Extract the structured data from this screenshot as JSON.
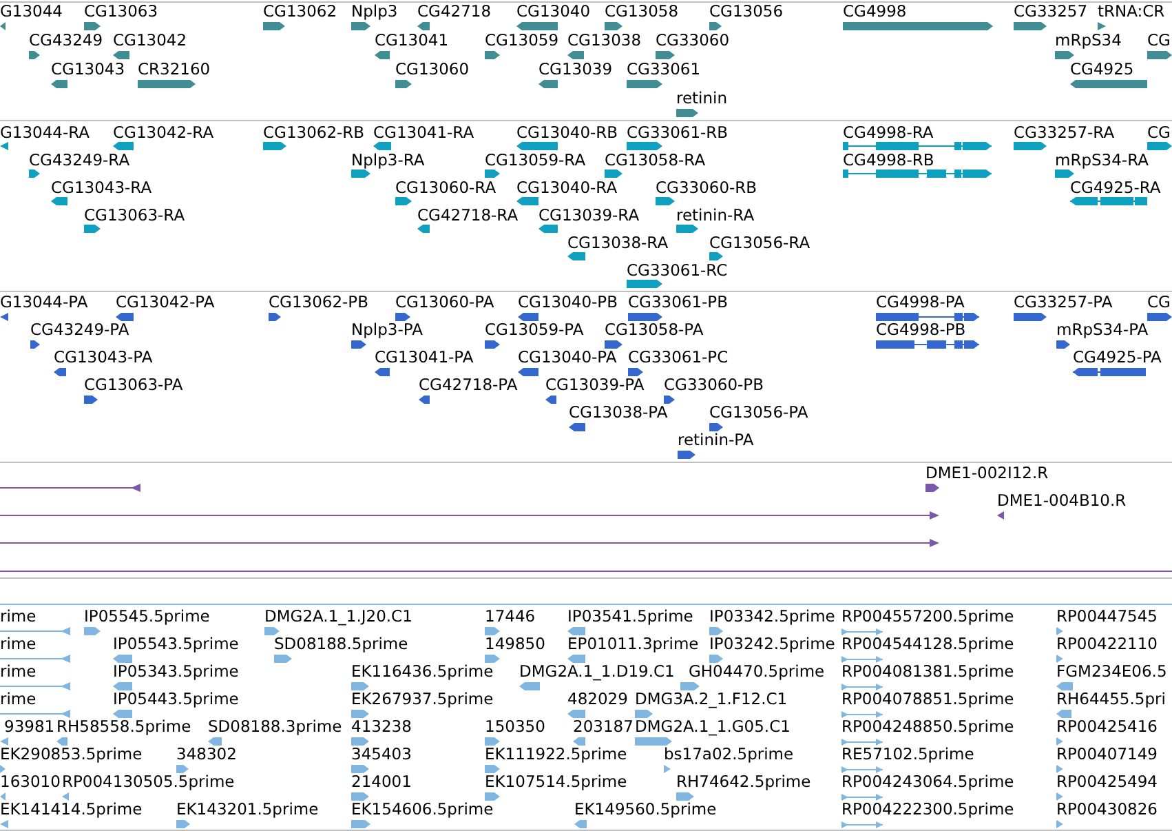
{
  "tracks": [
    {
      "kind": "gene",
      "color": "#418d93",
      "rows": [
        {
          "features": [
            {
              "label": "G13044",
              "reverse": true
            },
            {
              "label": "CG13063",
              "reverse": false
            },
            {
              "label": "CG13062",
              "reverse": false
            },
            {
              "label": "Nplp3",
              "reverse": false
            },
            {
              "label": "CG42718",
              "reverse": true
            },
            {
              "label": "CG13040",
              "reverse": true
            },
            {
              "label": "CG13058",
              "reverse": false
            },
            {
              "label": "CG13056",
              "reverse": false
            },
            {
              "label": "CG4998",
              "reverse": false
            },
            {
              "label": "CG33257",
              "reverse": false
            },
            {
              "label": "tRNA:CR",
              "reverse": false
            }
          ]
        },
        {
          "features": [
            {
              "label": "CG43249",
              "reverse": false
            },
            {
              "label": "CG13042",
              "reverse": true
            },
            {
              "label": "CG13041",
              "reverse": true
            },
            {
              "label": "CG13059",
              "reverse": false
            },
            {
              "label": "CG13038",
              "reverse": true
            },
            {
              "label": "CG33060",
              "reverse": false
            },
            {
              "label": "mRpS34",
              "reverse": false
            },
            {
              "label": "CG",
              "reverse": false
            }
          ]
        },
        {
          "features": [
            {
              "label": "CG13043",
              "reverse": true
            },
            {
              "label": "CR32160",
              "reverse": false
            },
            {
              "label": "CG13060",
              "reverse": false
            },
            {
              "label": "CG13039",
              "reverse": true
            },
            {
              "label": "CG33061",
              "reverse": false
            },
            {
              "label": "CG4925",
              "reverse": true
            }
          ]
        },
        {
          "features": [
            {
              "label": "retinin",
              "reverse": false
            }
          ]
        }
      ]
    },
    {
      "kind": "transcript",
      "color": "#10a0bf",
      "rows": [
        {
          "features": [
            {
              "label": "G13044-RA",
              "reverse": true
            },
            {
              "label": "CG13042-RA",
              "reverse": true
            },
            {
              "label": "CG13062-RB",
              "reverse": false
            },
            {
              "label": "CG13041-RA",
              "reverse": true
            },
            {
              "label": "CG13040-RB",
              "reverse": true
            },
            {
              "label": "CG33061-RB",
              "reverse": false
            },
            {
              "label": "CG4998-RA",
              "reverse": false
            },
            {
              "label": "CG33257-RA",
              "reverse": false
            },
            {
              "label": "CG",
              "reverse": false
            }
          ]
        },
        {
          "features": [
            {
              "label": "CG43249-RA",
              "reverse": false
            },
            {
              "label": "Nplp3-RA",
              "reverse": false
            },
            {
              "label": "CG13059-RA",
              "reverse": false
            },
            {
              "label": "CG13058-RA",
              "reverse": false
            },
            {
              "label": "CG4998-RB",
              "reverse": false
            },
            {
              "label": "mRpS34-RA",
              "reverse": false
            }
          ]
        },
        {
          "features": [
            {
              "label": "CG13043-RA",
              "reverse": true
            },
            {
              "label": "CG13060-RA",
              "reverse": false
            },
            {
              "label": "CG13040-RA",
              "reverse": true
            },
            {
              "label": "CG33060-RB",
              "reverse": false
            },
            {
              "label": "CG4925-RA",
              "reverse": true
            }
          ]
        },
        {
          "features": [
            {
              "label": "CG13063-RA",
              "reverse": false
            },
            {
              "label": "CG42718-RA",
              "reverse": true
            },
            {
              "label": "CG13039-RA",
              "reverse": true
            },
            {
              "label": "retinin-RA",
              "reverse": false
            }
          ]
        },
        {
          "features": [
            {
              "label": "CG13038-RA",
              "reverse": true
            },
            {
              "label": "CG13056-RA",
              "reverse": false
            }
          ]
        },
        {
          "features": [
            {
              "label": "CG33061-RC",
              "reverse": false
            }
          ]
        }
      ]
    },
    {
      "kind": "protein",
      "color": "#3468cc",
      "rows": [
        {
          "features": [
            {
              "label": "G13044-PA",
              "reverse": true
            },
            {
              "label": "CG13042-PA",
              "reverse": true
            },
            {
              "label": "CG13062-PB",
              "reverse": false
            },
            {
              "label": "CG13060-PA",
              "reverse": false
            },
            {
              "label": "CG13040-PB",
              "reverse": true
            },
            {
              "label": "CG33061-PB",
              "reverse": false
            },
            {
              "label": "CG4998-PA",
              "reverse": false
            },
            {
              "label": "CG33257-PA",
              "reverse": false
            },
            {
              "label": "CG",
              "reverse": false
            }
          ]
        },
        {
          "features": [
            {
              "label": "CG43249-PA",
              "reverse": false
            },
            {
              "label": "Nplp3-PA",
              "reverse": false
            },
            {
              "label": "CG13059-PA",
              "reverse": false
            },
            {
              "label": "CG13058-PA",
              "reverse": false
            },
            {
              "label": "CG4998-PB",
              "reverse": false
            },
            {
              "label": "mRpS34-PA",
              "reverse": false
            }
          ]
        },
        {
          "features": [
            {
              "label": "CG13043-PA",
              "reverse": true
            },
            {
              "label": "CG13041-PA",
              "reverse": true
            },
            {
              "label": "CG13040-PA",
              "reverse": true
            },
            {
              "label": "CG33061-PC",
              "reverse": false
            },
            {
              "label": "CG4925-PA",
              "reverse": true
            }
          ]
        },
        {
          "features": [
            {
              "label": "CG13063-PA",
              "reverse": false
            },
            {
              "label": "CG42718-PA",
              "reverse": true
            },
            {
              "label": "CG13039-PA",
              "reverse": true
            },
            {
              "label": "CG33060-PB",
              "reverse": false
            }
          ]
        },
        {
          "features": [
            {
              "label": "CG13038-PA",
              "reverse": true
            },
            {
              "label": "CG13056-PA",
              "reverse": false
            }
          ]
        },
        {
          "features": [
            {
              "label": "retinin-PA",
              "reverse": false
            }
          ]
        }
      ]
    },
    {
      "kind": "clone",
      "color": "#7b58a8",
      "rows": [
        {
          "features": [
            {
              "reverse": true
            },
            {
              "label": "DME1-002I12.R",
              "reverse": false
            }
          ]
        },
        {
          "features": [
            {
              "reverse": false
            },
            {
              "label": "DME1-004B10.R",
              "reverse": true
            }
          ]
        },
        {
          "features": [
            {
              "reverse": false
            }
          ]
        },
        {
          "features": [
            {
              "reverse": false
            }
          ]
        }
      ]
    },
    {
      "kind": "est",
      "color": "#80b6e0",
      "rows": [
        {
          "features": [
            {
              "label": "rime",
              "reverse": true
            },
            {
              "label": "IP05545.5prime",
              "reverse": false
            },
            {
              "label": "DMG2A.1_1.J20.C1",
              "reverse": false
            },
            {
              "label": "17446",
              "reverse": false
            },
            {
              "label": "IP03541.5prime",
              "reverse": true
            },
            {
              "label": "IP03342.5prime",
              "reverse": false
            },
            {
              "label": "RP004557200.5prime",
              "reverse": false
            },
            {
              "label": "RP00447545",
              "reverse": false
            }
          ]
        },
        {
          "features": [
            {
              "label": "rime",
              "reverse": true
            },
            {
              "label": "IP05543.5prime",
              "reverse": true
            },
            {
              "label": "SD08188.5prime",
              "reverse": false
            },
            {
              "label": "149850",
              "reverse": false
            },
            {
              "label": "EP01011.3prime",
              "reverse": true
            },
            {
              "label": "IP03242.5prime",
              "reverse": false
            },
            {
              "label": "RP004544128.5prime",
              "reverse": false
            },
            {
              "label": "RP00422110",
              "reverse": false
            }
          ]
        },
        {
          "features": [
            {
              "label": "rime",
              "reverse": true
            },
            {
              "label": "IP05343.5prime",
              "reverse": true
            },
            {
              "label": "EK116436.5prime",
              "reverse": false
            },
            {
              "label": "DMG2A.1_1.D19.C1",
              "reverse": true
            },
            {
              "label": "GH04470.5prime",
              "reverse": false
            },
            {
              "label": "RP004081381.5prime",
              "reverse": false
            },
            {
              "label": "FGM234E06.5",
              "reverse": true
            }
          ]
        },
        {
          "features": [
            {
              "label": "rime",
              "reverse": true
            },
            {
              "label": "IP05443.5prime",
              "reverse": true
            },
            {
              "label": "EK267937.5prime",
              "reverse": false
            },
            {
              "label": "482029",
              "reverse": true
            },
            {
              "label": "DMG3A.2_1.F12.C1",
              "reverse": false
            },
            {
              "label": "RP004078851.5prime",
              "reverse": false
            },
            {
              "label": "RH64455.5pri",
              "reverse": true
            }
          ]
        },
        {
          "features": [
            {
              "label": "93981",
              "reverse": true
            },
            {
              "label": "RH58558.5prime",
              "reverse": true
            },
            {
              "label": "SD08188.3prime",
              "reverse": true
            },
            {
              "label": "413238",
              "reverse": false
            },
            {
              "label": "150350",
              "reverse": false
            },
            {
              "label": "203187",
              "reverse": true
            },
            {
              "label": "DMG2A.1_1.G05.C1",
              "reverse": false
            },
            {
              "label": "RP004248850.5prime",
              "reverse": false
            },
            {
              "label": "RP00425416",
              "reverse": false
            }
          ]
        },
        {
          "features": [
            {
              "label": "EK290853.5prime",
              "reverse": false
            },
            {
              "label": "348302",
              "reverse": false
            },
            {
              "label": "345403",
              "reverse": false
            },
            {
              "label": "EK111922.5prime",
              "reverse": false
            },
            {
              "label": "bs17a02.5prime",
              "reverse": false
            },
            {
              "label": "RE57102.5prime",
              "reverse": false
            },
            {
              "label": "RP00407149",
              "reverse": false
            }
          ]
        },
        {
          "features": [
            {
              "label": "163010",
              "reverse": true
            },
            {
              "label": "RP004130505.5prime",
              "reverse": true
            },
            {
              "label": "214001",
              "reverse": false
            },
            {
              "label": "EK107514.5prime",
              "reverse": false
            },
            {
              "label": "RH74642.5prime",
              "reverse": false
            },
            {
              "label": "RP004243064.5prime",
              "reverse": false
            },
            {
              "label": "RP00425494",
              "reverse": false
            }
          ]
        },
        {
          "features": [
            {
              "label": "EK141414.5prime",
              "reverse": true
            },
            {
              "label": "EK143201.5prime",
              "reverse": false
            },
            {
              "label": "EK154606.5prime",
              "reverse": false
            },
            {
              "label": "EK149560.5prime",
              "reverse": true
            },
            {
              "label": "RP004222300.5prime",
              "reverse": false
            },
            {
              "label": "RP00430826",
              "reverse": false
            }
          ]
        }
      ]
    }
  ]
}
